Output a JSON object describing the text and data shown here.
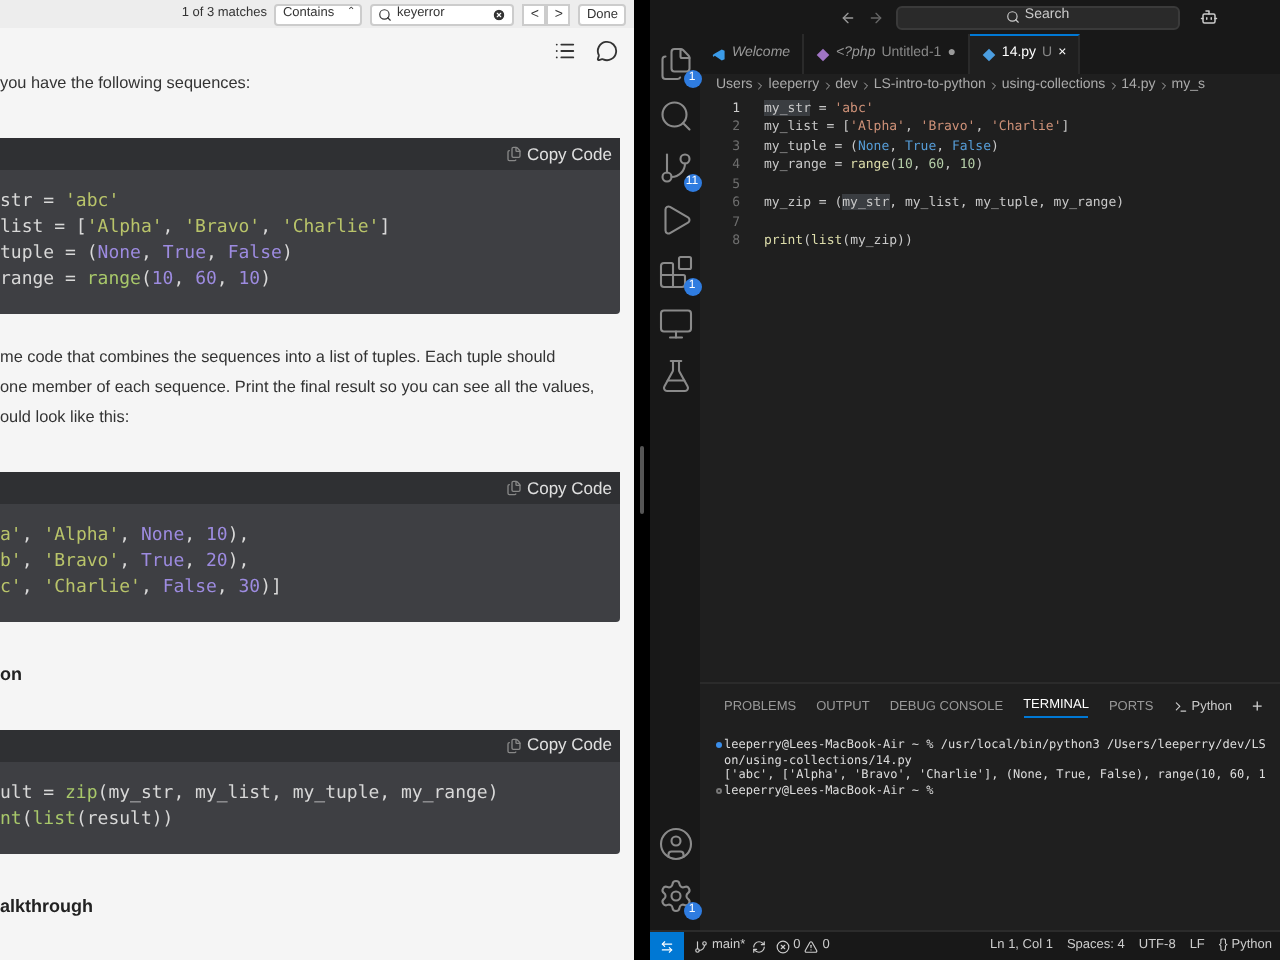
{
  "find_bar": {
    "matches": "1 of 3 matches",
    "mode": "Contains",
    "mode_arrow": "⌃",
    "query": "keyerror",
    "prev": "<",
    "next": ">",
    "done": "Done"
  },
  "article": [
    {
      "kind": "text",
      "text": "you have the following sequences:"
    },
    {
      "kind": "code",
      "copy": "Copy Code",
      "lines": [
        [
          {
            "text": "str = ",
            "kind": "plain"
          },
          {
            "text": "'abc'",
            "kind": "string"
          }
        ],
        [
          {
            "text": "list = [",
            "kind": "plain"
          },
          {
            "text": "'Alpha'",
            "kind": "string"
          },
          {
            "text": ", ",
            "kind": "plain"
          },
          {
            "text": "'Bravo'",
            "kind": "string"
          },
          {
            "text": ", ",
            "kind": "plain"
          },
          {
            "text": "'Charlie'",
            "kind": "string"
          },
          {
            "text": "]",
            "kind": "plain"
          }
        ],
        [
          {
            "text": "tuple = (",
            "kind": "plain"
          },
          {
            "text": "None",
            "kind": "keyword"
          },
          {
            "text": ", ",
            "kind": "plain"
          },
          {
            "text": "True",
            "kind": "keyword"
          },
          {
            "text": ", ",
            "kind": "plain"
          },
          {
            "text": "False",
            "kind": "keyword"
          },
          {
            "text": ")",
            "kind": "plain"
          }
        ],
        [
          {
            "text": "range = ",
            "kind": "plain"
          },
          {
            "text": "range",
            "kind": "function"
          },
          {
            "text": "(",
            "kind": "plain"
          },
          {
            "text": "10",
            "kind": "number"
          },
          {
            "text": ", ",
            "kind": "plain"
          },
          {
            "text": "60",
            "kind": "number"
          },
          {
            "text": ", ",
            "kind": "plain"
          },
          {
            "text": "10",
            "kind": "number"
          },
          {
            "text": ")",
            "kind": "plain"
          }
        ]
      ]
    },
    {
      "kind": "text",
      "text": "me code that combines the sequences into a list of tuples. Each tuple should"
    },
    {
      "kind": "text",
      "text": "one member of each sequence. Print the final result so you can see all the values,"
    },
    {
      "kind": "text",
      "text": "ould look like this:"
    },
    {
      "kind": "code",
      "copy": "Copy Code",
      "lines": [
        [
          {
            "text": "a'",
            "kind": "string"
          },
          {
            "text": ", ",
            "kind": "plain"
          },
          {
            "text": "'Alpha'",
            "kind": "string"
          },
          {
            "text": ", ",
            "kind": "plain"
          },
          {
            "text": "None",
            "kind": "keyword"
          },
          {
            "text": ", ",
            "kind": "plain"
          },
          {
            "text": "10",
            "kind": "number"
          },
          {
            "text": "),",
            "kind": "plain"
          }
        ],
        [
          {
            "text": "b'",
            "kind": "string"
          },
          {
            "text": ", ",
            "kind": "plain"
          },
          {
            "text": "'Bravo'",
            "kind": "string"
          },
          {
            "text": ", ",
            "kind": "plain"
          },
          {
            "text": "True",
            "kind": "keyword"
          },
          {
            "text": ", ",
            "kind": "plain"
          },
          {
            "text": "20",
            "kind": "number"
          },
          {
            "text": "),",
            "kind": "plain"
          }
        ],
        [
          {
            "text": "c'",
            "kind": "string"
          },
          {
            "text": ", ",
            "kind": "plain"
          },
          {
            "text": "'Charlie'",
            "kind": "string"
          },
          {
            "text": ", ",
            "kind": "plain"
          },
          {
            "text": "False",
            "kind": "keyword"
          },
          {
            "text": ", ",
            "kind": "plain"
          },
          {
            "text": "30",
            "kind": "number"
          },
          {
            "text": ")]",
            "kind": "plain"
          }
        ]
      ]
    },
    {
      "kind": "heading",
      "text": "on"
    },
    {
      "kind": "code",
      "copy": "Copy Code",
      "lines": [
        [
          {
            "text": "ult = ",
            "kind": "plain"
          },
          {
            "text": "zip",
            "kind": "function"
          },
          {
            "text": "(my_str, my_list, my_tuple, my_range)",
            "kind": "plain"
          }
        ],
        [
          {
            "text": "nt",
            "kind": "function"
          },
          {
            "text": "(",
            "kind": "plain"
          },
          {
            "text": "list",
            "kind": "function"
          },
          {
            "text": "(result))",
            "kind": "plain"
          }
        ]
      ]
    },
    {
      "kind": "heading",
      "text": "alkthrough"
    }
  ],
  "vscode": {
    "search": "Search",
    "activity": [
      {
        "kind": "files",
        "badge": "1"
      },
      {
        "kind": "search"
      },
      {
        "kind": "scm",
        "badge": "11"
      },
      {
        "kind": "run"
      },
      {
        "kind": "extensions",
        "badge": "1"
      },
      {
        "kind": "remote"
      },
      {
        "kind": "flask"
      }
    ],
    "activity_bottom": [
      {
        "kind": "account"
      },
      {
        "kind": "gear",
        "badge": "1"
      }
    ],
    "tabs": [
      {
        "kind": "vscode",
        "label": "Welcome",
        "selected": false
      },
      {
        "kind": "php",
        "label": "<?php",
        "detail": "Untitled-1",
        "dot": "●",
        "selected": false
      },
      {
        "kind": "py",
        "label": "14.py",
        "detail": "U",
        "close": "×",
        "selected": true
      }
    ],
    "breadcrumb": [
      "Users",
      "leeperry",
      "dev",
      "LS-intro-to-python",
      "using-collections",
      "14.py",
      "my_s"
    ],
    "lines": [
      {
        "n": "1",
        "tokens": [
          {
            "text": "my_str",
            "kind": "highlight"
          },
          {
            "text": " = ",
            "kind": "plain"
          },
          {
            "text": "'abc'",
            "kind": "string"
          }
        ]
      },
      {
        "n": "2",
        "tokens": [
          {
            "text": "my_list = [",
            "kind": "plain"
          },
          {
            "text": "'Alpha'",
            "kind": "string"
          },
          {
            "text": ", ",
            "kind": "plain"
          },
          {
            "text": "'Bravo'",
            "kind": "string"
          },
          {
            "text": ", ",
            "kind": "plain"
          },
          {
            "text": "'Charlie'",
            "kind": "string"
          },
          {
            "text": "]",
            "kind": "plain"
          }
        ]
      },
      {
        "n": "3",
        "tokens": [
          {
            "text": "my_tuple = (",
            "kind": "plain"
          },
          {
            "text": "None",
            "kind": "keyword"
          },
          {
            "text": ", ",
            "kind": "plain"
          },
          {
            "text": "True",
            "kind": "keyword"
          },
          {
            "text": ", ",
            "kind": "plain"
          },
          {
            "text": "False",
            "kind": "keyword"
          },
          {
            "text": ")",
            "kind": "plain"
          }
        ]
      },
      {
        "n": "4",
        "tokens": [
          {
            "text": "my_range = ",
            "kind": "plain"
          },
          {
            "text": "range",
            "kind": "function"
          },
          {
            "text": "(",
            "kind": "plain"
          },
          {
            "text": "10",
            "kind": "number"
          },
          {
            "text": ", ",
            "kind": "plain"
          },
          {
            "text": "60",
            "kind": "number"
          },
          {
            "text": ", ",
            "kind": "plain"
          },
          {
            "text": "10",
            "kind": "number"
          },
          {
            "text": ")",
            "kind": "plain"
          }
        ]
      },
      {
        "n": "5"
      },
      {
        "n": "6",
        "tokens": [
          {
            "text": "my_zip = (",
            "kind": "plain"
          },
          {
            "text": "my_str",
            "kind": "highlight"
          },
          {
            "text": ", my_list, my_tuple, my_range)",
            "kind": "plain"
          }
        ]
      },
      {
        "n": "7"
      },
      {
        "n": "8",
        "tokens": [
          {
            "text": "print",
            "kind": "function"
          },
          {
            "text": "(",
            "kind": "plain"
          },
          {
            "text": "list",
            "kind": "function"
          },
          {
            "text": "(my_zip))",
            "kind": "plain"
          }
        ]
      }
    ],
    "panel_tabs": [
      {
        "label": "PROBLEMS",
        "selected": false
      },
      {
        "label": "OUTPUT",
        "selected": false
      },
      {
        "label": "DEBUG CONSOLE",
        "selected": false
      },
      {
        "label": "TERMINAL",
        "selected": true
      },
      {
        "label": "PORTS",
        "selected": false
      }
    ],
    "terminal_profile": "Python",
    "terminal_add": "+",
    "terminal": [
      {
        "kind": "cmd",
        "text": "leeperry@Lees-MacBook-Air ~ % /usr/local/bin/python3 /Users/leeperry/dev/LS"
      },
      {
        "kind": "out",
        "text": "on/using-collections/14.py"
      },
      {
        "kind": "out",
        "text": "['abc', ['Alpha', 'Bravo', 'Charlie'], (None, True, False), range(10, 60, 1"
      },
      {
        "kind": "prompt",
        "text": "leeperry@Lees-MacBook-Air ~ %"
      }
    ],
    "status": {
      "branch": "main*",
      "errors": "0",
      "warnings": "0",
      "position": "Ln 1, Col 1",
      "spaces": "Spaces: 4",
      "encoding": "UTF-8",
      "eol": "LF",
      "braces": "{}",
      "language": "Python"
    }
  }
}
